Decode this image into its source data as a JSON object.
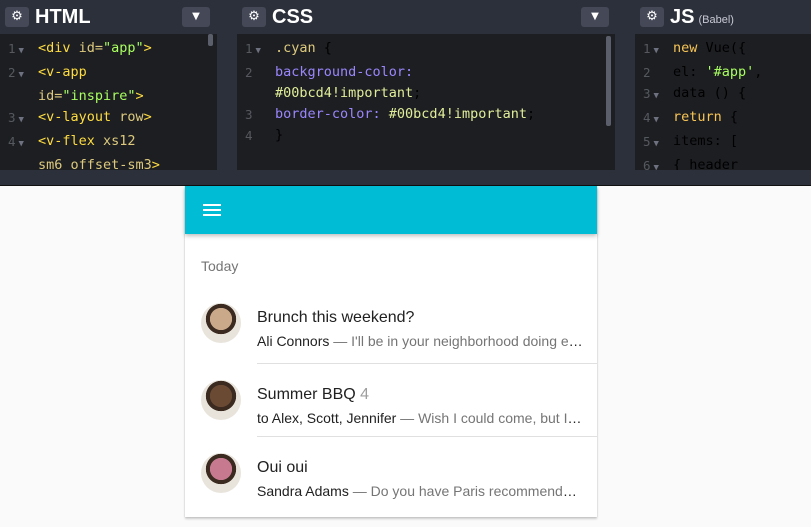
{
  "editors": {
    "html": {
      "title": "HTML",
      "lines": [
        {
          "n": "1",
          "fold": true,
          "parts": [
            {
              "t": "<div ",
              "c": "tag"
            },
            {
              "t": "id=",
              "c": "attr"
            },
            {
              "t": "\"app\"",
              "c": "str"
            },
            {
              "t": ">",
              "c": "tag"
            }
          ]
        },
        {
          "n": "2",
          "fold": true,
          "parts": [
            {
              "t": "  <v-app",
              "c": "tag"
            }
          ]
        },
        {
          "n": "",
          "fold": false,
          "parts": [
            {
              "t": "id=",
              "c": "attr"
            },
            {
              "t": "\"inspire\"",
              "c": "str"
            },
            {
              "t": ">",
              "c": "tag"
            }
          ]
        },
        {
          "n": "3",
          "fold": true,
          "parts": [
            {
              "t": "    <v-layout ",
              "c": "tag"
            },
            {
              "t": "row",
              "c": "attr"
            },
            {
              "t": ">",
              "c": "tag"
            }
          ]
        },
        {
          "n": "4",
          "fold": true,
          "parts": [
            {
              "t": "      <v-flex ",
              "c": "tag"
            },
            {
              "t": "xs12",
              "c": "attr"
            }
          ]
        },
        {
          "n": "",
          "fold": false,
          "parts": [
            {
              "t": "sm6 offset-sm3",
              "c": "attr"
            },
            {
              "t": ">",
              "c": "tag"
            }
          ]
        }
      ]
    },
    "css": {
      "title": "CSS",
      "lines": [
        {
          "n": "1",
          "fold": true,
          "parts": [
            {
              "t": ".cyan ",
              "c": "sel"
            },
            {
              "t": "{",
              "c": "ln"
            }
          ]
        },
        {
          "n": "2",
          "fold": false,
          "parts": [
            {
              "t": "    background-color:",
              "c": "prop"
            }
          ]
        },
        {
          "n": "",
          "fold": false,
          "parts": [
            {
              "t": "#00bcd4!important",
              "c": "val"
            },
            {
              "t": ";",
              "c": "ln"
            }
          ]
        },
        {
          "n": "3",
          "fold": false,
          "parts": [
            {
              "t": "    border-color: ",
              "c": "prop"
            },
            {
              "t": "#00bcd4!important",
              "c": "val"
            },
            {
              "t": ";",
              "c": "ln"
            }
          ]
        },
        {
          "n": "4",
          "fold": false,
          "parts": [
            {
              "t": "}",
              "c": "ln"
            }
          ]
        }
      ]
    },
    "js": {
      "title": "JS",
      "subtitle": "(Babel)",
      "lines": [
        {
          "n": "1",
          "fold": true,
          "parts": [
            {
              "t": "new ",
              "c": "kw"
            },
            {
              "t": "Vue({",
              "c": "ln"
            }
          ]
        },
        {
          "n": "2",
          "fold": false,
          "parts": [
            {
              "t": "  el: ",
              "c": "ln"
            },
            {
              "t": "'#app'",
              "c": "str"
            },
            {
              "t": ",",
              "c": "ln"
            }
          ]
        },
        {
          "n": "3",
          "fold": true,
          "parts": [
            {
              "t": "  data () {",
              "c": "ln"
            }
          ]
        },
        {
          "n": "4",
          "fold": true,
          "parts": [
            {
              "t": "    ",
              "c": "ln"
            },
            {
              "t": "return",
              "c": "kw"
            },
            {
              "t": " {",
              "c": "ln"
            }
          ]
        },
        {
          "n": "5",
          "fold": true,
          "parts": [
            {
              "t": "      items: [",
              "c": "ln"
            }
          ]
        },
        {
          "n": "6",
          "fold": true,
          "parts": [
            {
              "t": "        { header",
              "c": "ln"
            }
          ]
        }
      ]
    }
  },
  "app": {
    "subheader": "Today",
    "items": [
      {
        "title": "Brunch this weekend?",
        "count": "",
        "from": "Ali Connors",
        "snippet": " — I'll be in your neighborhood doing errands this weekend. Do you want to hang out?",
        "avatar_color": "#c9a98a"
      },
      {
        "title": "Summer BBQ",
        "count": "4",
        "from": "to Alex, Scott, Jennifer",
        "snippet": " — Wish I could come, but I'm out of town this weekend.",
        "avatar_color": "#6b4a34"
      },
      {
        "title": "Oui oui",
        "count": "",
        "from": "Sandra Adams",
        "snippet": " — Do you have Paris recommendations? Have you ever been?",
        "avatar_color": "#c77a8f"
      }
    ]
  },
  "colors": {
    "accent": "#00bcd4",
    "editor_bg": "#1d1e22",
    "editor_head": "#2c303a"
  },
  "icons": [
    "gear-icon",
    "chevron-down-icon",
    "menu-icon"
  ]
}
